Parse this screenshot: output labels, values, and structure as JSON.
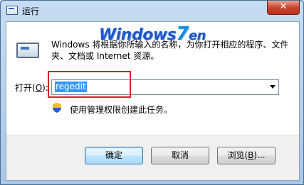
{
  "window": {
    "title": "运行",
    "close_glyph": "✕"
  },
  "logo": {
    "part1": "Windows",
    "part2": "7",
    "part3": "en"
  },
  "description": "Windows 将根据你所输入的名称，为你打开相应的程序、文件夹、文档或 Internet 资源。",
  "open_field": {
    "label_prefix": "打开(",
    "label_key": "O",
    "label_suffix": "):",
    "value": "regedit"
  },
  "admin_note": "使用管理权限创建此任务。",
  "buttons": {
    "ok": "确定",
    "cancel": "取消",
    "browse_prefix": "浏览(",
    "browse_key": "B",
    "browse_suffix": ")..."
  },
  "colors": {
    "highlight": "#d8232a",
    "selection": "#3399ff",
    "close": "#c9472f"
  },
  "icons": [
    "run-icon",
    "close-icon",
    "uac-shield-icon",
    "dropdown-arrow-icon"
  ]
}
